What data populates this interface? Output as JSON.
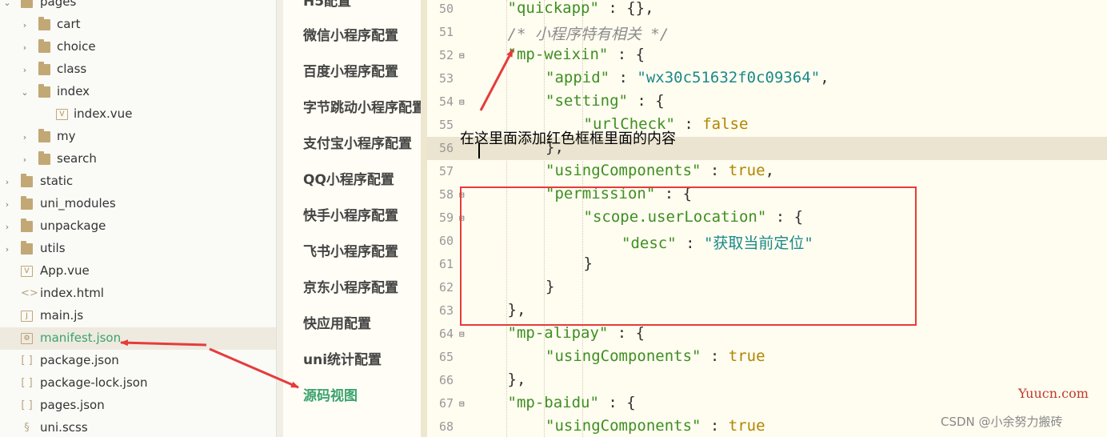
{
  "file_tree": [
    {
      "label": "pages",
      "type": "folder",
      "expanded": true,
      "depth": 0
    },
    {
      "label": "cart",
      "type": "folder",
      "expanded": false,
      "depth": 1
    },
    {
      "label": "choice",
      "type": "folder",
      "expanded": false,
      "depth": 1
    },
    {
      "label": "class",
      "type": "folder",
      "expanded": false,
      "depth": 1
    },
    {
      "label": "index",
      "type": "folder",
      "expanded": true,
      "depth": 1
    },
    {
      "label": "index.vue",
      "type": "vue",
      "depth": 2
    },
    {
      "label": "my",
      "type": "folder",
      "expanded": false,
      "depth": 1
    },
    {
      "label": "search",
      "type": "folder",
      "expanded": false,
      "depth": 1
    },
    {
      "label": "static",
      "type": "folder",
      "expanded": false,
      "depth": 0
    },
    {
      "label": "uni_modules",
      "type": "folder",
      "expanded": false,
      "depth": 0
    },
    {
      "label": "unpackage",
      "type": "folder",
      "expanded": false,
      "depth": 0
    },
    {
      "label": "utils",
      "type": "folder",
      "expanded": false,
      "depth": 0
    },
    {
      "label": "App.vue",
      "type": "vue",
      "depth": 0
    },
    {
      "label": "index.html",
      "type": "html",
      "depth": 0
    },
    {
      "label": "main.js",
      "type": "js",
      "depth": 0
    },
    {
      "label": "manifest.json",
      "type": "settings",
      "depth": 0,
      "active": true
    },
    {
      "label": "package.json",
      "type": "json",
      "depth": 0
    },
    {
      "label": "package-lock.json",
      "type": "json",
      "depth": 0
    },
    {
      "label": "pages.json",
      "type": "json",
      "depth": 0
    },
    {
      "label": "uni.scss",
      "type": "scss",
      "depth": 0
    }
  ],
  "config_nav": {
    "items": [
      "微信小程序配置",
      "百度小程序配置",
      "字节跳动小程序配置",
      "支付宝小程序配置",
      "QQ小程序配置",
      "快手小程序配置",
      "飞书小程序配置",
      "京东小程序配置",
      "快应用配置",
      "uni统计配置",
      "源码视图"
    ],
    "active_index": 10
  },
  "editor": {
    "lines": [
      {
        "n": "50",
        "fold": false,
        "indent": 1,
        "tokens": [
          [
            "k",
            "\"quickapp\""
          ],
          [
            "p",
            " : {},"
          ]
        ]
      },
      {
        "n": "51",
        "fold": false,
        "indent": 1,
        "tokens": [
          [
            "c",
            "/* 小程序特有相关 */"
          ]
        ]
      },
      {
        "n": "52",
        "fold": true,
        "indent": 1,
        "tokens": [
          [
            "k",
            "\"mp-weixin\""
          ],
          [
            "p",
            " : {"
          ]
        ]
      },
      {
        "n": "53",
        "fold": false,
        "indent": 2,
        "tokens": [
          [
            "k",
            "\"appid\""
          ],
          [
            "p",
            " : "
          ],
          [
            "s",
            "\"wx30c51632f0c09364\""
          ],
          [
            "p",
            ","
          ]
        ]
      },
      {
        "n": "54",
        "fold": true,
        "indent": 2,
        "tokens": [
          [
            "k",
            "\"setting\""
          ],
          [
            "p",
            " : {"
          ]
        ]
      },
      {
        "n": "55",
        "fold": false,
        "indent": 3,
        "tokens": [
          [
            "k",
            "\"urlCheck\""
          ],
          [
            "p",
            " : "
          ],
          [
            "b",
            "false"
          ]
        ]
      },
      {
        "n": "56",
        "fold": false,
        "indent": 2,
        "highlight": true,
        "tokens": [
          [
            "p",
            "},"
          ]
        ]
      },
      {
        "n": "57",
        "fold": false,
        "indent": 2,
        "tokens": [
          [
            "k",
            "\"usingComponents\""
          ],
          [
            "p",
            " : "
          ],
          [
            "b",
            "true"
          ],
          [
            "p",
            ","
          ]
        ]
      },
      {
        "n": "58",
        "fold": true,
        "indent": 2,
        "tokens": [
          [
            "k",
            "\"permission\""
          ],
          [
            "p",
            " : {"
          ]
        ]
      },
      {
        "n": "59",
        "fold": true,
        "indent": 3,
        "tokens": [
          [
            "k",
            "\"scope.userLocation\""
          ],
          [
            "p",
            " : {"
          ]
        ]
      },
      {
        "n": "60",
        "fold": false,
        "indent": 4,
        "tokens": [
          [
            "k",
            "\"desc\""
          ],
          [
            "p",
            " : "
          ],
          [
            "s",
            "\"获取当前定位\""
          ]
        ]
      },
      {
        "n": "61",
        "fold": false,
        "indent": 3,
        "tokens": [
          [
            "p",
            "}"
          ]
        ]
      },
      {
        "n": "62",
        "fold": false,
        "indent": 2,
        "tokens": [
          [
            "p",
            "}"
          ]
        ]
      },
      {
        "n": "63",
        "fold": false,
        "indent": 1,
        "tokens": [
          [
            "p",
            "},"
          ]
        ]
      },
      {
        "n": "64",
        "fold": true,
        "indent": 1,
        "tokens": [
          [
            "k",
            "\"mp-alipay\""
          ],
          [
            "p",
            " : {"
          ]
        ]
      },
      {
        "n": "65",
        "fold": false,
        "indent": 2,
        "tokens": [
          [
            "k",
            "\"usingComponents\""
          ],
          [
            "p",
            " : "
          ],
          [
            "b",
            "true"
          ]
        ]
      },
      {
        "n": "66",
        "fold": false,
        "indent": 1,
        "tokens": [
          [
            "p",
            "},"
          ]
        ]
      },
      {
        "n": "67",
        "fold": true,
        "indent": 1,
        "tokens": [
          [
            "k",
            "\"mp-baidu\""
          ],
          [
            "p",
            " : {"
          ]
        ]
      },
      {
        "n": "68",
        "fold": false,
        "indent": 2,
        "tokens": [
          [
            "k",
            "\"usingComponents\""
          ],
          [
            "p",
            " : "
          ],
          [
            "b",
            "true"
          ]
        ]
      }
    ]
  },
  "annotation": {
    "text": "在这里面添加红色框框里面的内容",
    "color": "#e63b3b"
  },
  "watermarks": {
    "site": "Yuucn.com",
    "author": "CSDN @小余努力搬砖"
  }
}
